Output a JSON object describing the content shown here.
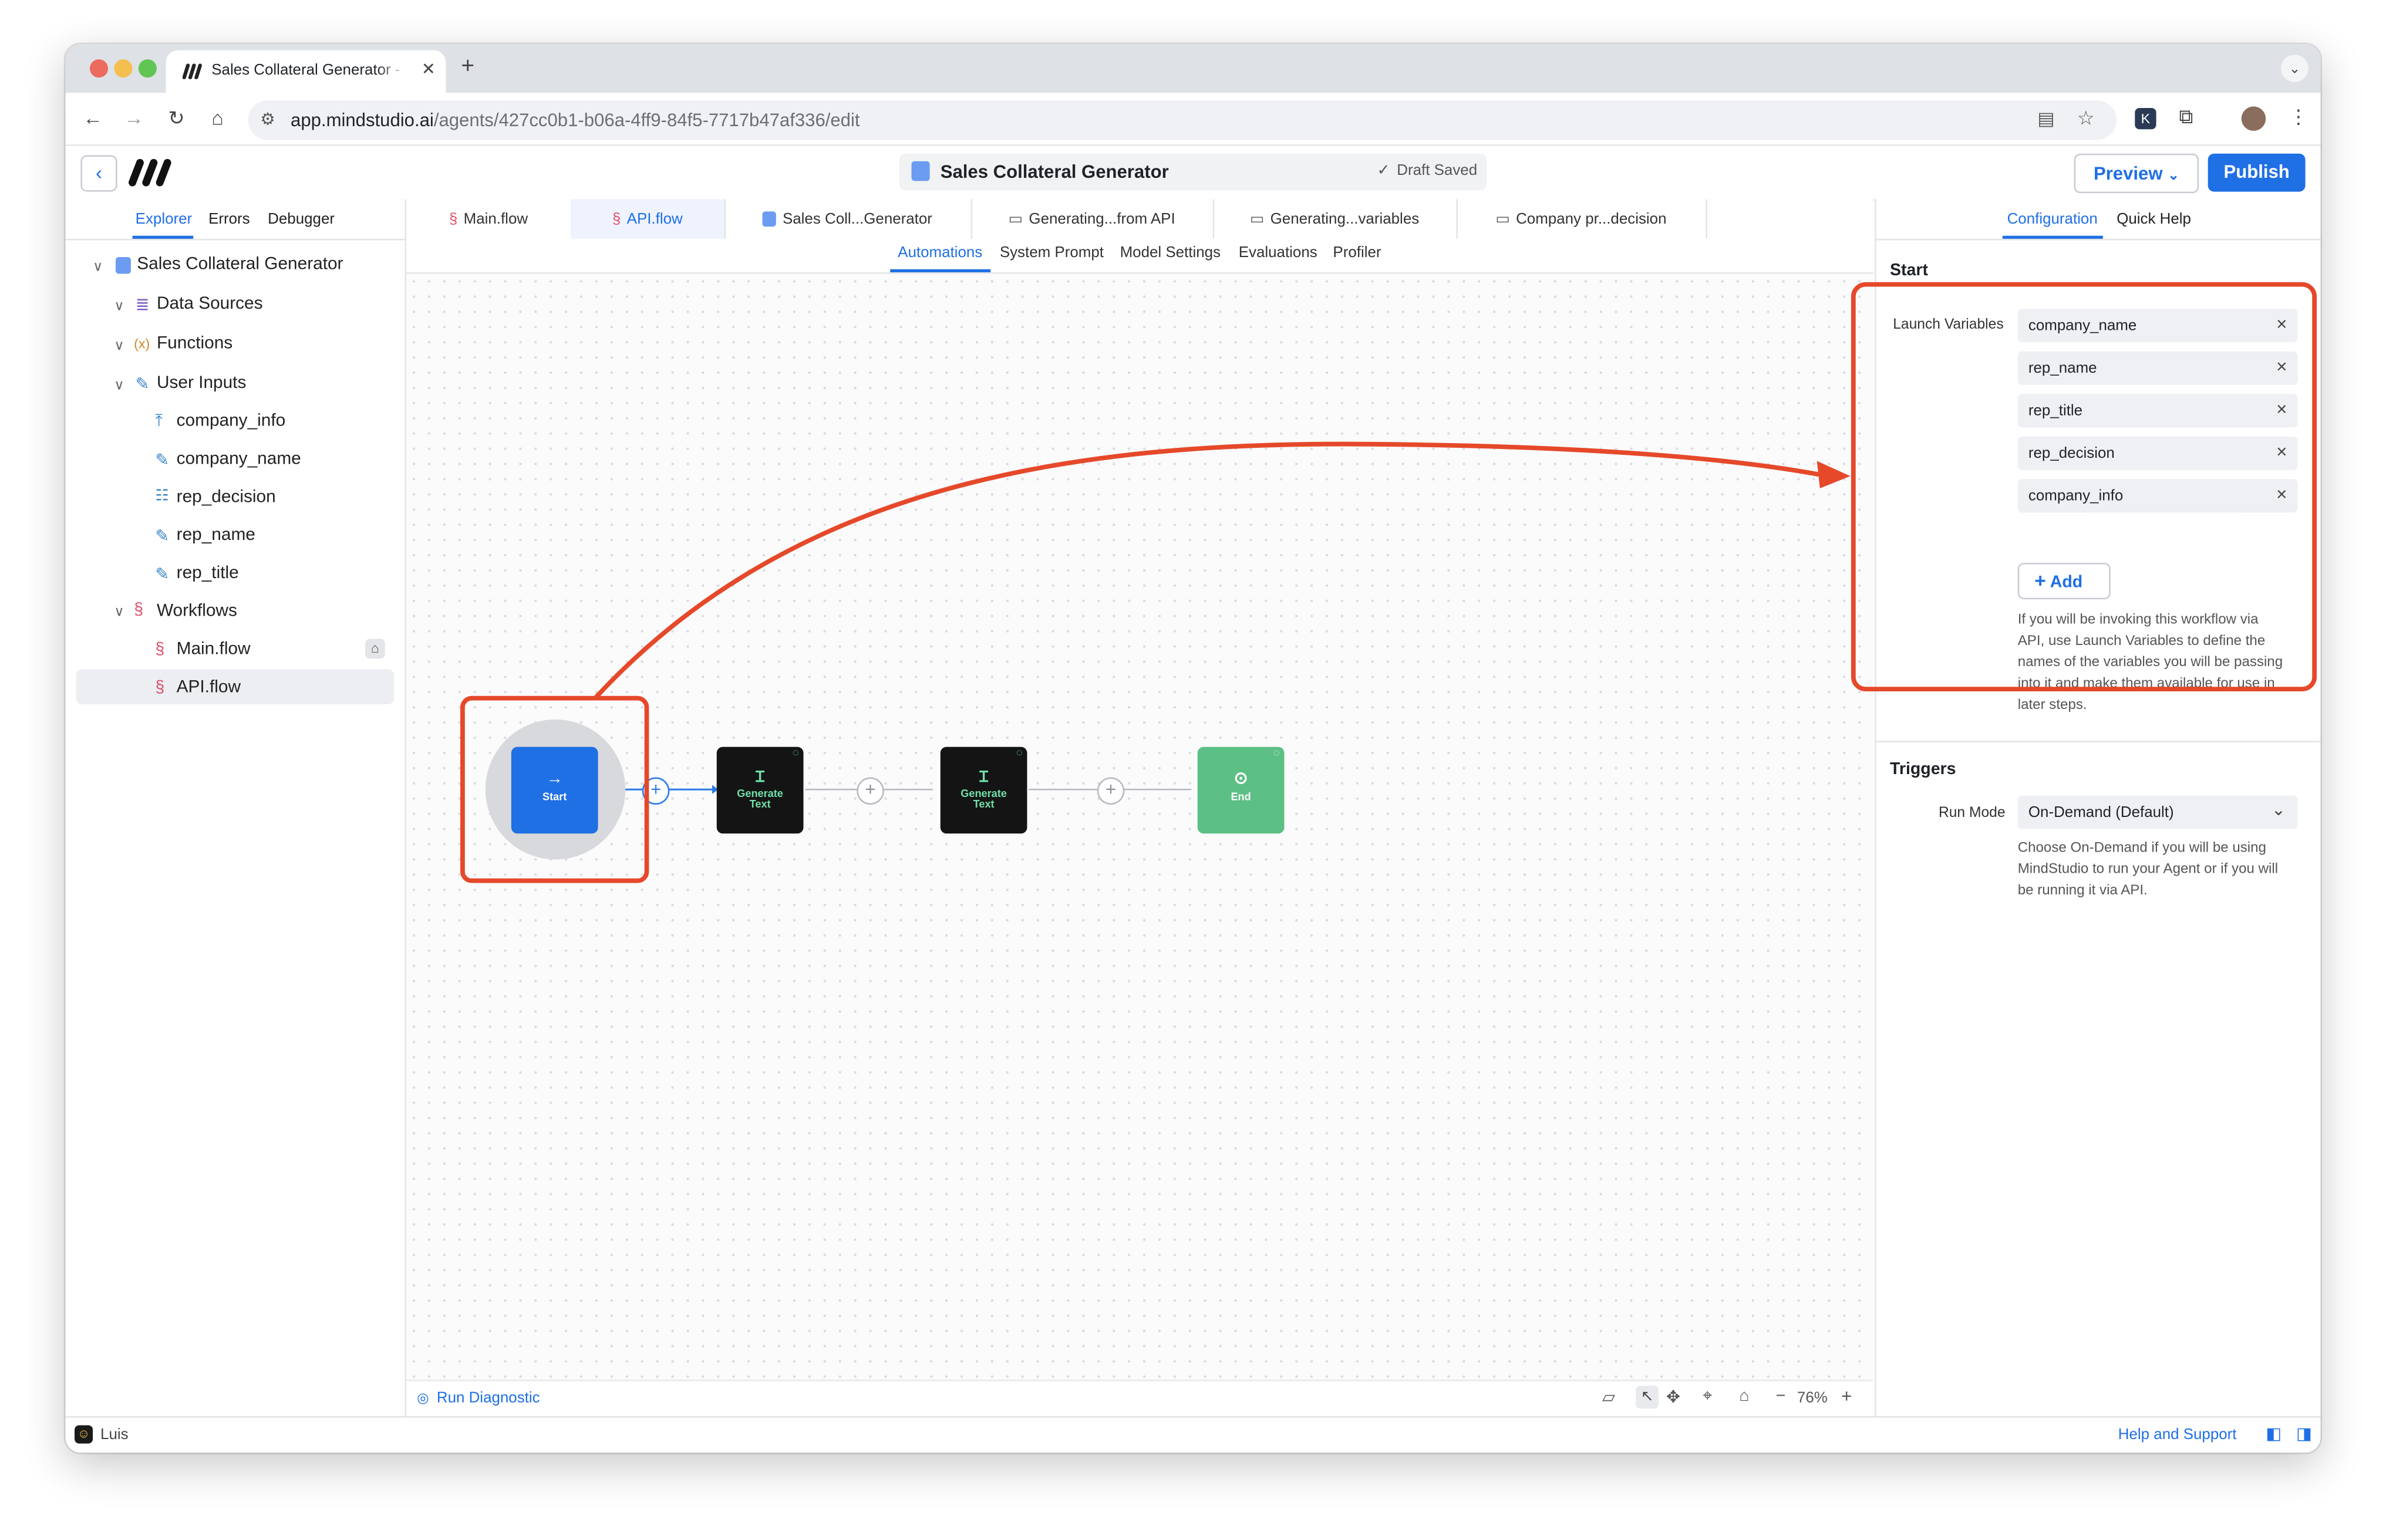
{
  "browser": {
    "tab_title": "Sales Collateral Generator - MindStudio",
    "new_tab": "+",
    "url_host": "app.mindstudio.ai",
    "url_path": "/agents/427cc0b1-b06a-4ff9-84f5-7717b47af336/edit"
  },
  "header": {
    "agent_name": "Sales Collateral Generator",
    "save_status": "Draft Saved",
    "preview_label": "Preview",
    "publish_label": "Publish"
  },
  "left_tabs": [
    "Explorer",
    "Errors",
    "Debugger"
  ],
  "tree": {
    "root": "Sales Collateral Generator",
    "data_sources": "Data Sources",
    "functions": "Functions",
    "user_inputs": "User Inputs",
    "inputs": [
      "company_info",
      "company_name",
      "rep_decision",
      "rep_name",
      "rep_title"
    ],
    "workflows": "Workflows",
    "flows": [
      "Main.flow",
      "API.flow"
    ]
  },
  "file_tabs": [
    "Main.flow",
    "API.flow",
    "Sales Coll...Generator",
    "Generating...from API",
    "Generating...variables",
    "Company pr...decision"
  ],
  "sub_tabs": [
    "Automations",
    "System Prompt",
    "Model Settings",
    "Evaluations",
    "Profiler"
  ],
  "nodes": {
    "start": "Start",
    "gen1": [
      "Generate",
      "Text"
    ],
    "gen2": [
      "Generate",
      "Text"
    ],
    "end": "End"
  },
  "canvas_footer": {
    "run_diagnostic": "Run Diagnostic",
    "zoom": "76%"
  },
  "right_tabs": [
    "Configuration",
    "Quick Help"
  ],
  "config": {
    "section_start": "Start",
    "launch_label": "Launch Variables",
    "launch_vars": [
      "company_name",
      "rep_name",
      "rep_title",
      "rep_decision",
      "company_info"
    ],
    "add_label": "Add",
    "launch_help": [
      "If you will be invoking this workflow via",
      "API, use Launch Variables to define the",
      "names of the variables you will be passing",
      "into it and make them available for use in",
      "later steps."
    ],
    "section_triggers": "Triggers",
    "run_mode_label": "Run Mode",
    "run_mode_value": "On-Demand (Default)",
    "run_mode_help": [
      "Choose On-Demand if you will be using",
      "MindStudio to run your Agent or if you will",
      "be running it via API."
    ]
  },
  "status": {
    "user": "Luis",
    "help": "Help and Support"
  },
  "colors": {
    "accent": "#1f6fe5",
    "annotation": "#e5492a",
    "node_start": "#1f6fe5",
    "node_generate": "#141414",
    "node_end": "#5cbf84"
  }
}
